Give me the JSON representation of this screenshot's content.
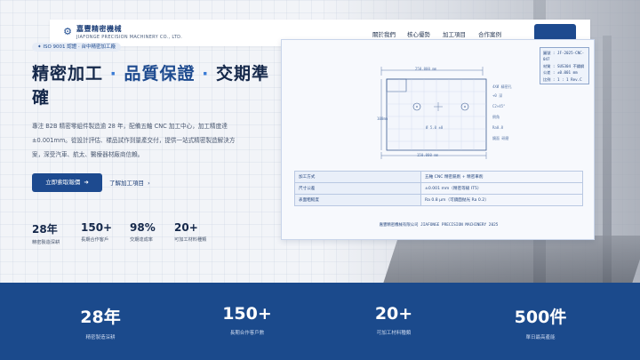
{
  "brand": {
    "name_cn": "嘉豐精密機械",
    "name_en": "JIAFONGE PRECISION MACHINERY CO., LTD.",
    "logo_icon": "gear-icon"
  },
  "nav": {
    "items": [
      "關於我們",
      "核心優勢",
      "加工項目",
      "合作案例"
    ],
    "cta_label": ""
  },
  "hero": {
    "badge": "✦ ISO 9001 認證 · 台中精密加工廠",
    "title_part1": "精密加工",
    "title_part2": "品質保證",
    "title_part3": "交期準確",
    "dot": "·",
    "description": "專注 B2B 精密零組件製造逾 28 年，配備五軸 CNC 加工中心，加工精度達 ±0.001mm。從設計評估、樣品試作到量產交付，提供一站式精密製造解決方案，深受汽車、航太、醫療器材廠商信賴。",
    "primary_button": "立即索取報價",
    "secondary_link": "了解加工項目"
  },
  "mini_stats": [
    {
      "value": "28年",
      "label": "精密製造深耕"
    },
    {
      "value": "150+",
      "label": "長期合作客戶"
    },
    {
      "value": "98%",
      "label": "交期達成率"
    },
    {
      "value": "20+",
      "label": "可加工材料種類"
    }
  ],
  "drawing": {
    "title_block": [
      "圖號 : JF-2025-CNC-047",
      "材質 : SUS304 不鏽鋼",
      "公差 : ±0.001 mm",
      "比例 : 1 : 1   Rev.C"
    ],
    "dim_top": "250.000 mm",
    "dim_bottom": "150.000 mm",
    "dim_side": "100mm",
    "hole_note": "Ø 5.0 ±0",
    "side_notes": [
      "4XØ 精密孔",
      "+0 深",
      "C2×45°",
      "倒角",
      "Ra0.8",
      "鏡面 研磨"
    ],
    "specs": [
      {
        "key": "加工方式",
        "value": "五軸 CNC 精密銑削 + 精密車削"
      },
      {
        "key": "尺寸公差",
        "value": "±0.001 mm（精密等級 IT5）"
      },
      {
        "key": "表面粗糙度",
        "value": "Ra 0.8 μm（可鏡面拋光 Ra 0.2）"
      }
    ],
    "footer": "嘉豐精密機械有限公司  JIAFONGE PRECISION MACHINERY  2025"
  },
  "band_stats": [
    {
      "value": "28年",
      "label": "精密製造深耕"
    },
    {
      "value": "150+",
      "label": "長期合作客戶數"
    },
    {
      "value": "20+",
      "label": "可加工材料種類"
    },
    {
      "value": "500件",
      "label": "單日最高產能"
    }
  ],
  "colors": {
    "primary": "#1d4a8f",
    "band": "#1b4a8c",
    "accent_dot": "#3a7bd5"
  }
}
